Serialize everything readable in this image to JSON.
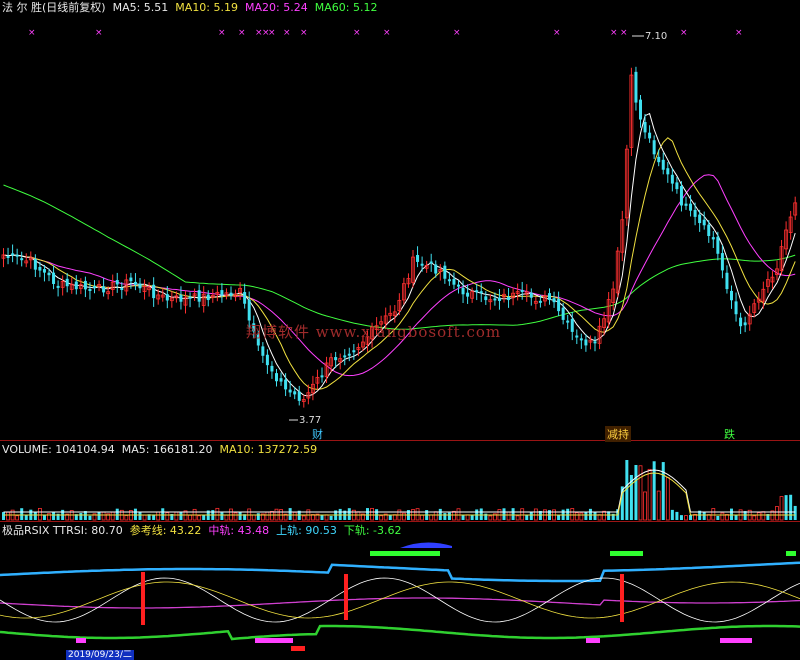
{
  "header_main": {
    "stock": "法 尔 胜(日线前复权)",
    "ma5": "MA5: 5.51",
    "ma10": "MA10: 5.19",
    "ma20": "MA20: 5.24",
    "ma60": "MA60: 5.12"
  },
  "header_volume": {
    "volume": "VOLUME: 104104.94",
    "ma5": "MA5: 166181.20",
    "ma10": "MA10: 137272.59"
  },
  "header_rsix": {
    "name": "极品RSIX TTRSI: 80.70",
    "ref": "参考线: 43.22",
    "mid": "中轨: 43.48",
    "upper": "上轨: 90.53",
    "lower": "下轨: -3.62"
  },
  "annotations": {
    "high_price": "7.10",
    "low_price": "3.77",
    "watermark": "翔博软件 www.xiangbosoft.com",
    "tag_cai": "财",
    "tag_jianchi": "减持",
    "tag_die": "跌"
  },
  "colors": {
    "up": "#ff3030",
    "down": "#40e0f0",
    "ma5": "#ffffff",
    "ma10": "#f0e040",
    "ma20": "#ff40ff",
    "ma60": "#40ff40",
    "separator": "#9a1414"
  },
  "footer_dates": {
    "d1": "2019/09/23/二"
  }
}
